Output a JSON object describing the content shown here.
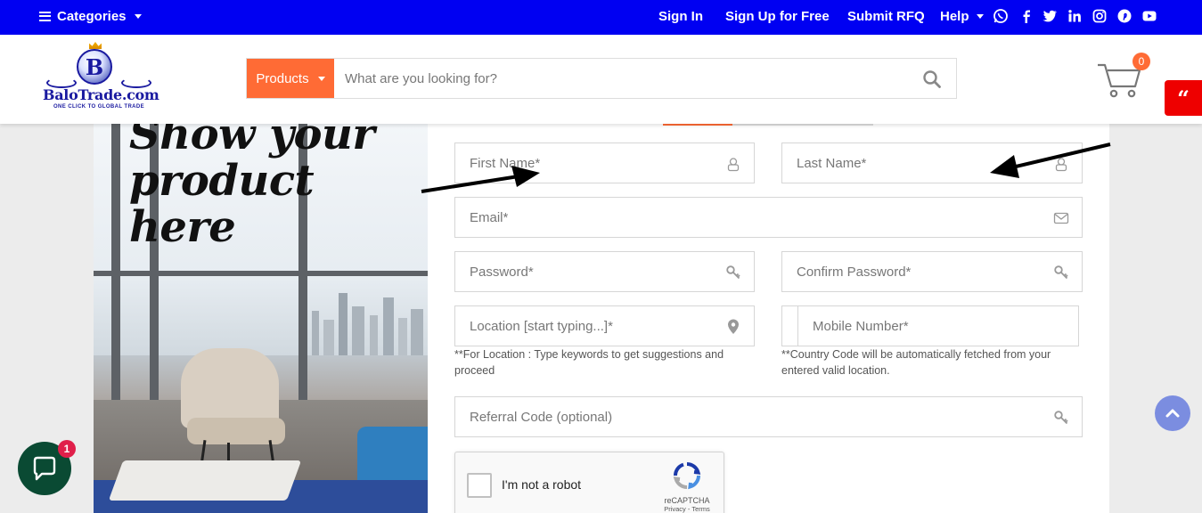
{
  "topbar": {
    "categories_label": "Categories",
    "links": [
      "Sign In",
      "Sign Up for Free",
      "Submit RFQ",
      "Help"
    ],
    "social_icons": [
      "whatsapp-icon",
      "facebook-icon",
      "twitter-icon",
      "linkedin-icon",
      "instagram-icon",
      "pinterest-icon",
      "youtube-icon"
    ],
    "bg_color": "#0000f2"
  },
  "header": {
    "logo": {
      "name": "BaloTrade.com",
      "letter": "B",
      "tagline": "ONE CLICK TO GLOBAL TRADE"
    },
    "search": {
      "category_label": "Products",
      "placeholder": "What are you looking for?"
    },
    "cart_count": "0",
    "accent_color": "#ff6b35"
  },
  "promo": {
    "headline": "Show your product here"
  },
  "form": {
    "first_name_placeholder": "First Name*",
    "last_name_placeholder": "Last Name*",
    "email_placeholder": "Email*",
    "password_placeholder": "Password*",
    "confirm_password_placeholder": "Confirm Password*",
    "location_placeholder": "Location [start typing...]*",
    "mobile_placeholder": "Mobile Number*",
    "location_help": "**For Location : Type keywords to get suggestions and proceed",
    "mobile_help": "**Country Code will be automatically fetched from your entered valid location.",
    "referral_placeholder": "Referral Code (optional)"
  },
  "captcha": {
    "label": "I'm not a robot",
    "brand": "reCAPTCHA",
    "terms": "Privacy - Terms"
  },
  "chat": {
    "badge": "1"
  }
}
